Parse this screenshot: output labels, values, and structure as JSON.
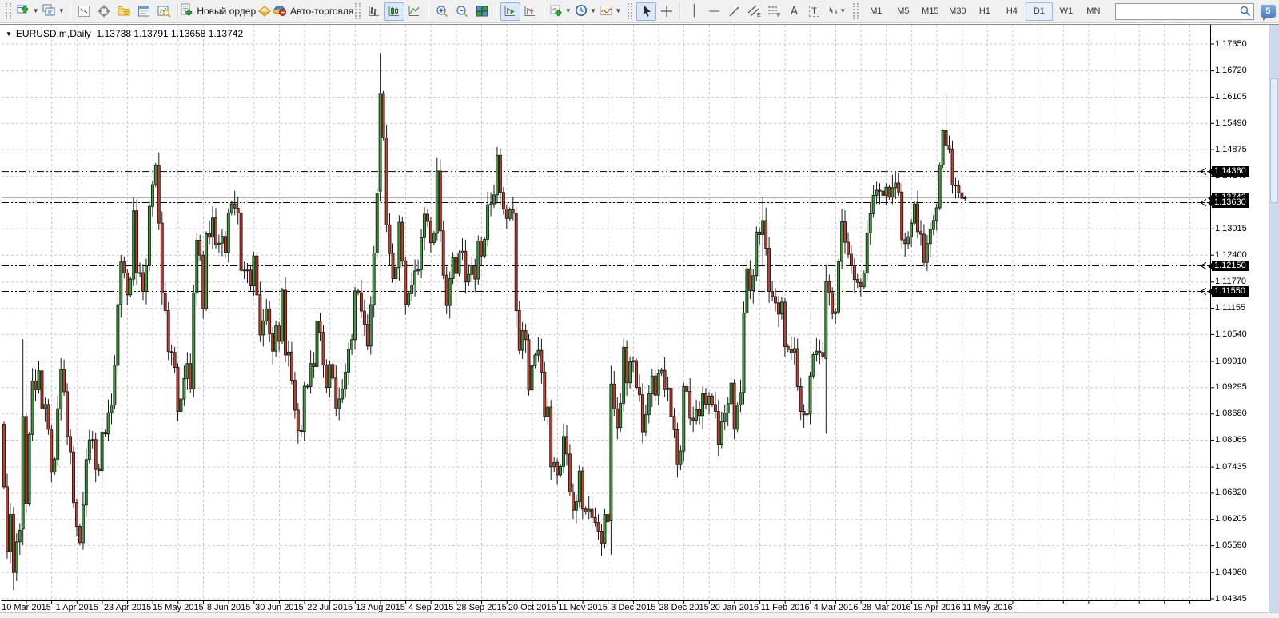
{
  "toolbar": {
    "new_order_label": "Новый ордер",
    "autotrade_label": "Авто-торговля",
    "timeframes": [
      "M1",
      "M5",
      "M15",
      "M30",
      "H1",
      "H4",
      "D1",
      "W1",
      "MN"
    ],
    "active_timeframe": "D1",
    "search_value": "",
    "badge_count": "5",
    "channel_sub": "E",
    "fibo_sub": "F",
    "text_tool": "A",
    "text_label_tool": "T"
  },
  "chart": {
    "title_symbol": "EURUSD.m,Daily",
    "title_quotes": "1.13738 1.13791 1.13658 1.13742"
  },
  "chart_data": {
    "type": "candlestick",
    "symbol": "EURUSD.m",
    "period": "Daily",
    "ylim": [
      1.04345,
      1.1735
    ],
    "grid": true,
    "price_ticks": [
      "1.17350",
      "1.16720",
      "1.16105",
      "1.15490",
      "1.14875",
      "1.14245",
      "1.13630",
      "1.13015",
      "1.12400",
      "1.11770",
      "1.11155",
      "1.10540",
      "1.09910",
      "1.09295",
      "1.08680",
      "1.08065",
      "1.07435",
      "1.06820",
      "1.06205",
      "1.05590",
      "1.04960",
      "1.04345"
    ],
    "date_labels": [
      "10 Mar 2015",
      "1 Apr 2015",
      "23 Apr 2015",
      "15 May 2015",
      "8 Jun 2015",
      "30 Jun 2015",
      "22 Jul 2015",
      "13 Aug 2015",
      "4 Sep 2015",
      "28 Sep 2015",
      "20 Oct 2015",
      "11 Nov 2015",
      "3 Dec 2015",
      "28 Dec 2015",
      "20 Jan 2016",
      "11 Feb 2016",
      "4 Mar 2016",
      "28 Mar 2016",
      "19 Apr 2016",
      "11 May 2016"
    ],
    "hlines": [
      1.1436,
      1.1363,
      1.1215,
      1.1155
    ],
    "hline_labels": [
      "1.14360",
      "1.13630",
      "1.12150",
      "1.11550"
    ],
    "bid": 1.13742,
    "bid_label": "1.13742",
    "first_open": 1.0844,
    "closes": [
      1.0697,
      1.0545,
      1.0632,
      1.0496,
      1.0568,
      1.0595,
      1.0862,
      1.0658,
      1.082,
      1.0945,
      1.0925,
      1.0969,
      1.088,
      1.089,
      1.0832,
      1.0731,
      1.0762,
      1.088,
      1.0972,
      1.092,
      1.0815,
      1.0779,
      1.066,
      1.0604,
      1.0566,
      1.0654,
      1.0761,
      1.0807,
      1.0808,
      1.0738,
      1.0735,
      1.0825,
      1.0821,
      1.0871,
      1.0889,
      1.0982,
      1.1124,
      1.1224,
      1.1198,
      1.1147,
      1.1184,
      1.1344,
      1.1198,
      1.1199,
      1.1155,
      1.1215,
      1.1354,
      1.1405,
      1.145,
      1.1315,
      1.1151,
      1.111,
      1.1014,
      1.1012,
      1.0977,
      1.0874,
      1.0903,
      1.0951,
      1.0986,
      1.0927,
      1.1151,
      1.1275,
      1.124,
      1.1115,
      1.129,
      1.1282,
      1.1327,
      1.1265,
      1.1268,
      1.1284,
      1.1246,
      1.1339,
      1.136,
      1.135,
      1.1339,
      1.1204,
      1.1205,
      1.1205,
      1.1168,
      1.1238,
      1.1147,
      1.1053,
      1.1086,
      1.1114,
      1.1056,
      1.1015,
      1.1074,
      1.1038,
      1.1158,
      1.1006,
      1.1013,
      1.0947,
      1.0877,
      1.0829,
      1.0827,
      1.0933,
      1.0932,
      1.0986,
      1.0979,
      1.1085,
      1.1059,
      1.0983,
      1.093,
      1.0984,
      1.0952,
      1.088,
      1.0903,
      1.0926,
      1.0966,
      1.1019,
      1.1042,
      1.1156,
      1.1152,
      1.1109,
      1.1078,
      1.1027,
      1.1124,
      1.1245,
      1.1384,
      1.1619,
      1.1515,
      1.1311,
      1.1244,
      1.1185,
      1.1211,
      1.1317,
      1.1226,
      1.1124,
      1.115,
      1.117,
      1.1203,
      1.1206,
      1.1281,
      1.1336,
      1.1319,
      1.1269,
      1.1291,
      1.1437,
      1.1297,
      1.1193,
      1.1122,
      1.1185,
      1.1234,
      1.1197,
      1.1245,
      1.1249,
      1.1177,
      1.1195,
      1.1215,
      1.1184,
      1.1273,
      1.1238,
      1.1277,
      1.1358,
      1.136,
      1.1381,
      1.1474,
      1.1387,
      1.1348,
      1.1326,
      1.1346,
      1.1338,
      1.111,
      1.1017,
      1.1063,
      1.1042,
      1.0924,
      1.0981,
      1.1006,
      1.1017,
      1.0966,
      1.0862,
      1.0884,
      1.0744,
      1.0754,
      1.0725,
      1.0745,
      1.0815,
      1.0774,
      1.0685,
      1.0642,
      1.0662,
      1.0734,
      1.0645,
      1.0638,
      1.0644,
      1.0625,
      1.0613,
      1.0593,
      1.0565,
      1.0632,
      1.0615,
      1.0938,
      1.088,
      1.0836,
      1.0893,
      1.1024,
      1.0941,
      1.099,
      1.0993,
      1.093,
      1.0913,
      1.0826,
      1.0866,
      1.0915,
      1.0957,
      1.0912,
      1.0963,
      1.097,
      1.0925,
      1.0928,
      1.0862,
      1.0831,
      1.0749,
      1.0781,
      1.0932,
      1.0921,
      1.0858,
      1.0853,
      1.0878,
      1.0864,
      1.0916,
      1.0891,
      1.091,
      1.089,
      1.0874,
      1.0797,
      1.085,
      1.087,
      1.0892,
      1.094,
      1.0832,
      1.0889,
      1.0918,
      1.1104,
      1.1208,
      1.1157,
      1.1192,
      1.1294,
      1.1288,
      1.1321,
      1.1256,
      1.1155,
      1.1143,
      1.1128,
      1.1102,
      1.113,
      1.1026,
      1.1019,
      1.1011,
      1.1021,
      1.0932,
      1.0874,
      1.0866,
      1.0868,
      1.0957,
      1.1007,
      1.1015,
      1.1012,
      1.1001,
      1.1178,
      1.1152,
      1.1103,
      1.1107,
      1.1225,
      1.1318,
      1.127,
      1.1242,
      1.1216,
      1.1183,
      1.1176,
      1.1166,
      1.1198,
      1.1292,
      1.1337,
      1.138,
      1.1392,
      1.139,
      1.138,
      1.1399,
      1.1376,
      1.1398,
      1.1409,
      1.1388,
      1.1276,
      1.1267,
      1.1283,
      1.1315,
      1.136,
      1.1295,
      1.1289,
      1.1223,
      1.1267,
      1.13,
      1.1321,
      1.1351,
      1.1451,
      1.1532,
      1.1497,
      1.1489,
      1.1404,
      1.1403,
      1.1386,
      1.1373,
      1.13742
    ],
    "special_candles": {
      "3": [
        1.0632,
        1.065,
        1.0455,
        1.0496
      ],
      "6": [
        1.0598,
        1.1043,
        1.056,
        1.0862
      ],
      "119": [
        1.139,
        1.1714,
        1.1365,
        1.1619
      ],
      "162": [
        1.1338,
        1.1354,
        1.1072,
        1.111
      ],
      "192": [
        1.0617,
        1.0981,
        1.0538,
        1.0938
      ],
      "240": [
        1.1288,
        1.1376,
        1.1213,
        1.1321
      ],
      "260": [
        1.0998,
        1.1218,
        1.0822,
        1.1178
      ],
      "297": [
        1.1451,
        1.1535,
        1.1444,
        1.1532
      ],
      "298": [
        1.1532,
        1.1616,
        1.1468,
        1.1497
      ],
      "304": [
        1.13738,
        1.13791,
        1.13658,
        1.13742
      ]
    },
    "colors": {
      "up": "#3a9e3a",
      "down": "#cb3b2b",
      "wick": "#1a1a1a",
      "grid": "#c9c9c9",
      "hline": "#000000",
      "bid_line": "#b3b3b3",
      "frame": "#000000"
    }
  }
}
